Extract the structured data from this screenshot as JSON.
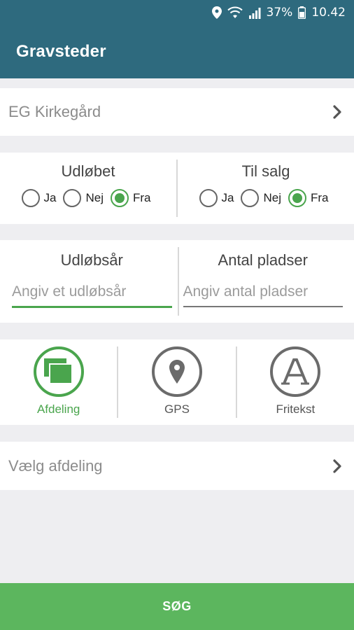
{
  "status_bar": {
    "battery": "37%",
    "time": "10.42",
    "icons": [
      "location-icon",
      "wifi-icon",
      "signal-icon",
      "battery-icon"
    ]
  },
  "app_bar": {
    "title": "Gravsteder"
  },
  "cemetery": {
    "label": "EG Kirkegård",
    "icon": "chevron-right-icon"
  },
  "expired": {
    "title": "Udløbet",
    "options": [
      "Ja",
      "Nej",
      "Fra"
    ],
    "selected": "Fra"
  },
  "for_sale": {
    "title": "Til salg",
    "options": [
      "Ja",
      "Nej",
      "Fra"
    ],
    "selected": "Fra"
  },
  "expiry_year": {
    "title": "Udløbsår",
    "placeholder": "Angiv et udløbsår",
    "value": ""
  },
  "num_places": {
    "title": "Antal pladser",
    "placeholder": "Angiv antal pladser",
    "value": ""
  },
  "search_modes": {
    "selected": "Afdeling",
    "items": [
      {
        "label": "Afdeling",
        "icon": "section-icon"
      },
      {
        "label": "GPS",
        "icon": "map-pin-icon"
      },
      {
        "label": "Fritekst",
        "icon": "text-icon"
      }
    ]
  },
  "section_select": {
    "label": "Vælg afdeling",
    "icon": "chevron-right-icon"
  },
  "search_button": {
    "label": "SØG"
  },
  "colors": {
    "primary": "#2e6a7e",
    "accent": "#4aa54d",
    "button": "#5cb65e",
    "background": "#eeeef1"
  }
}
